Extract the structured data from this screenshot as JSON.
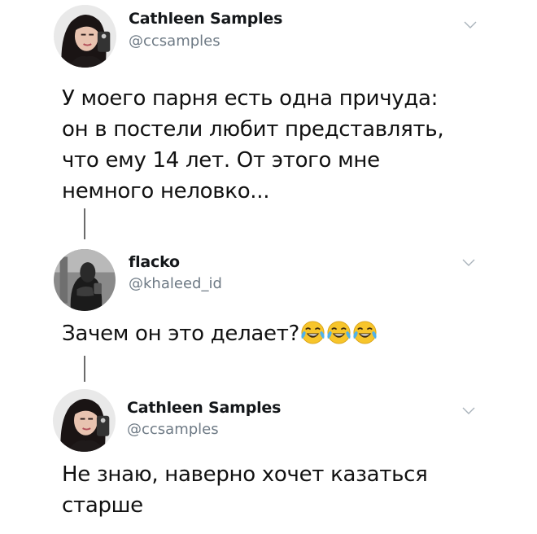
{
  "thread": [
    {
      "display_name": "Cathleen Samples",
      "handle": "@ccsamples",
      "text_lines": [
        "У моего парня есть одна причуда:",
        "он в постели любит представлять,",
        "что ему 14 лет. От этого мне",
        "немного неловко..."
      ]
    },
    {
      "display_name": "flacko",
      "handle": "@khaleed_id",
      "text_lines": [
        "Зачем он это делает?"
      ],
      "emojis": [
        "face-with-tears-of-joy",
        "face-with-tears-of-joy",
        "face-with-tears-of-joy"
      ]
    },
    {
      "display_name": "Cathleen Samples",
      "handle": "@ccsamples",
      "text_lines": [
        "Не знаю, наверно хочет казаться",
        "старше"
      ]
    }
  ],
  "icons": {
    "menu": "chevron-down-icon"
  },
  "colors": {
    "name": "#14171a",
    "handle": "#6e7a85",
    "connector": "#6b6b6b",
    "chevron": "#a9b3bb"
  }
}
